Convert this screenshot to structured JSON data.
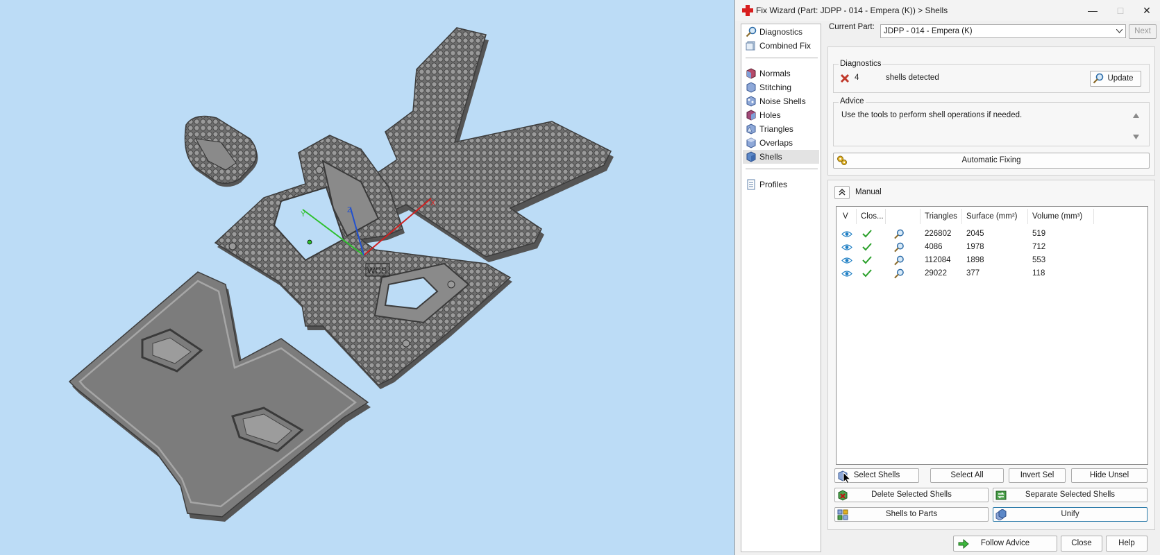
{
  "window": {
    "title": "Fix Wizard (Part: JDPP - 014 - Empera (K)) > Shells"
  },
  "viewport": {
    "axis_x": "X",
    "axis_y": "Y",
    "axis_z": "Z",
    "wcs_label": "WCS"
  },
  "nav": {
    "items": [
      {
        "label": "Diagnostics",
        "icon": "magnifier-icon"
      },
      {
        "label": "Combined Fix",
        "icon": "combined-fix-icon"
      },
      {
        "label": "Normals",
        "icon": "normals-icon"
      },
      {
        "label": "Stitching",
        "icon": "stitching-icon"
      },
      {
        "label": "Noise Shells",
        "icon": "noise-shells-icon"
      },
      {
        "label": "Holes",
        "icon": "holes-icon"
      },
      {
        "label": "Triangles",
        "icon": "triangles-icon"
      },
      {
        "label": "Overlaps",
        "icon": "overlaps-icon"
      },
      {
        "label": "Shells",
        "icon": "shells-icon"
      },
      {
        "label": "Profiles",
        "icon": "profiles-icon"
      }
    ],
    "selected": "Shells"
  },
  "current_part": {
    "label": "Current Part:",
    "value": "JDPP - 014 - Empera (K)",
    "next_label": "Next"
  },
  "diagnostics": {
    "title": "Diagnostics",
    "count": "4",
    "text": "shells detected",
    "update_label": "Update"
  },
  "advice": {
    "title": "Advice",
    "text": "Use the tools to perform shell operations if needed."
  },
  "automatic_fixing": {
    "label": "Automatic Fixing"
  },
  "manual": {
    "title": "Manual",
    "columns": {
      "visible": "V",
      "closed": "Clos...",
      "zoom": "",
      "triangles": "Triangles",
      "surface": "Surface (mm²)",
      "volume": "Volume (mm³)"
    },
    "rows": [
      {
        "triangles": "226802",
        "surface": "2045",
        "volume": "519"
      },
      {
        "triangles": "4086",
        "surface": "1978",
        "volume": "712"
      },
      {
        "triangles": "112084",
        "surface": "1898",
        "volume": "553"
      },
      {
        "triangles": "29022",
        "surface": "377",
        "volume": "118"
      }
    ]
  },
  "buttons": {
    "select_shells": "Select Shells",
    "select_all": "Select All",
    "invert_sel": "Invert Sel",
    "hide_unsel": "Hide Unsel",
    "delete_selected": "Delete Selected Shells",
    "separate_selected": "Separate Selected Shells",
    "shells_to_parts": "Shells to Parts",
    "unify": "Unify",
    "follow_advice": "Follow Advice",
    "close": "Close",
    "help": "Help"
  },
  "colors": {
    "viewport_bg": "#bcdcf6",
    "model_gray": "#7c7c7c",
    "check_green": "#2aa02a",
    "eye_blue": "#1f7fc4",
    "error_red": "#c0392b"
  }
}
